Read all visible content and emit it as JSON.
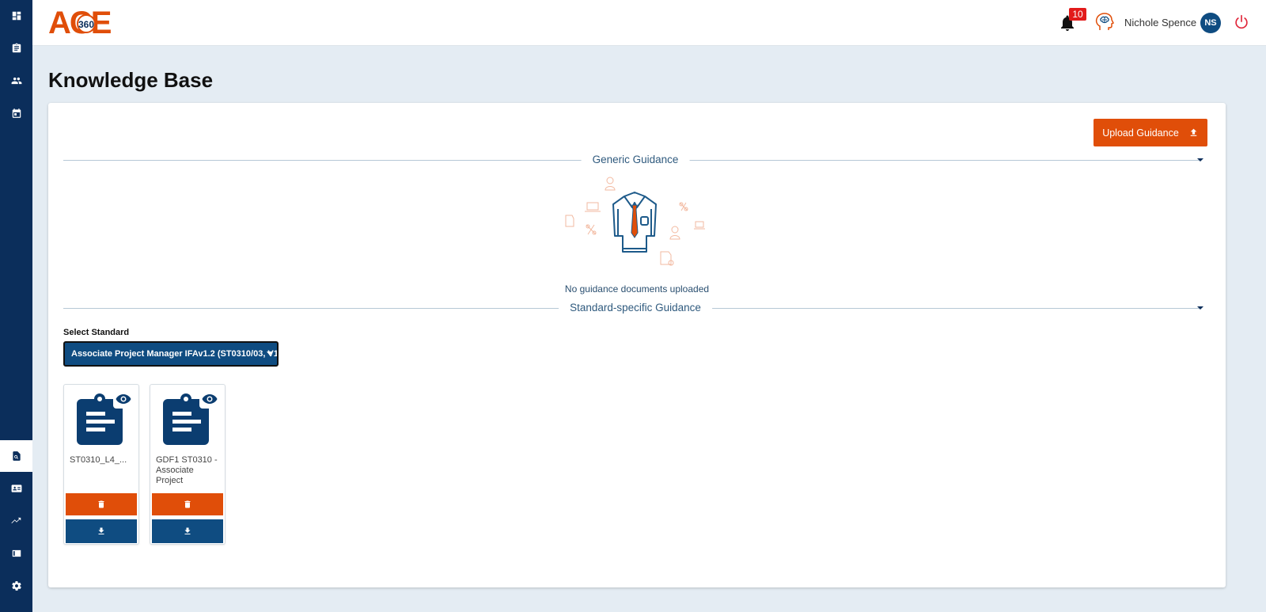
{
  "header": {
    "logo_text": "ACE",
    "logo_sub": "360",
    "notification_count": "10",
    "user_name": "Nichole Spence",
    "user_initials": "NS"
  },
  "page": {
    "title": "Knowledge Base"
  },
  "toolbar": {
    "upload_label": "Upload Guidance"
  },
  "sections": {
    "generic": "Generic Guidance",
    "standard": "Standard-specific Guidance"
  },
  "empty_state": {
    "text": "No guidance documents uploaded"
  },
  "select": {
    "label": "Select Standard",
    "value": "Associate Project Manager IFAv1.2 (ST0310/03, V1"
  },
  "documents": [
    {
      "name": "ST0310_L4_..."
    },
    {
      "name": "GDF1 ST0310 - Associate Project"
    }
  ],
  "colors": {
    "sidebar": "#0b2e5b",
    "accent_orange": "#e04e09",
    "primary_blue": "#0f4c81",
    "badge_red": "#e21b1b"
  }
}
